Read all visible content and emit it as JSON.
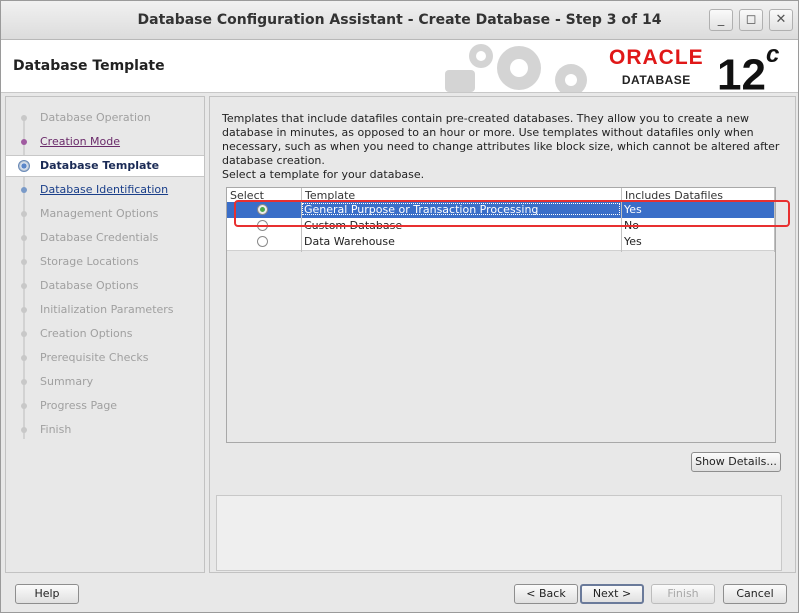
{
  "window": {
    "title": "Database Configuration Assistant - Create Database - Step 3 of 14",
    "minimize_icon": "minimize-icon",
    "maximize_icon": "maximize-icon",
    "close_icon": "close-icon"
  },
  "header": {
    "page_title": "Database Template",
    "logo_brand": "ORACLE",
    "logo_product": "DATABASE",
    "logo_version": "12",
    "logo_version_suffix": "c"
  },
  "steps": [
    {
      "label": "Database Operation",
      "state": "disabled"
    },
    {
      "label": "Creation Mode",
      "state": "done"
    },
    {
      "label": "Database Template",
      "state": "current"
    },
    {
      "label": "Database Identification",
      "state": "link"
    },
    {
      "label": "Management Options",
      "state": "disabled"
    },
    {
      "label": "Database Credentials",
      "state": "disabled"
    },
    {
      "label": "Storage Locations",
      "state": "disabled"
    },
    {
      "label": "Database Options",
      "state": "disabled"
    },
    {
      "label": "Initialization Parameters",
      "state": "disabled"
    },
    {
      "label": "Creation Options",
      "state": "disabled"
    },
    {
      "label": "Prerequisite Checks",
      "state": "disabled"
    },
    {
      "label": "Summary",
      "state": "disabled"
    },
    {
      "label": "Progress Page",
      "state": "disabled"
    },
    {
      "label": "Finish",
      "state": "disabled"
    }
  ],
  "content": {
    "description": "Templates that include datafiles contain pre-created databases. They allow you to create a new database in minutes, as opposed to an hour or more. Use templates without datafiles only when necessary, such as when you need to change attributes like block size, which cannot be altered after database creation.",
    "prompt": "Select a template for your database.",
    "table": {
      "headers": [
        "Select",
        "Template",
        "Includes Datafiles"
      ],
      "rows": [
        {
          "template": "General Purpose or Transaction Processing",
          "datafiles": "Yes",
          "selected": true
        },
        {
          "template": "Custom Database",
          "datafiles": "No",
          "selected": false
        },
        {
          "template": "Data Warehouse",
          "datafiles": "Yes",
          "selected": false
        }
      ]
    },
    "show_details": "Show Details..."
  },
  "buttons": {
    "help": "Help",
    "back": "< Back",
    "next": "Next >",
    "finish": "Finish",
    "cancel": "Cancel"
  },
  "colors": {
    "selection": "#3a6ec8",
    "highlight_box": "#e83030",
    "oracle_red": "#e01818"
  }
}
